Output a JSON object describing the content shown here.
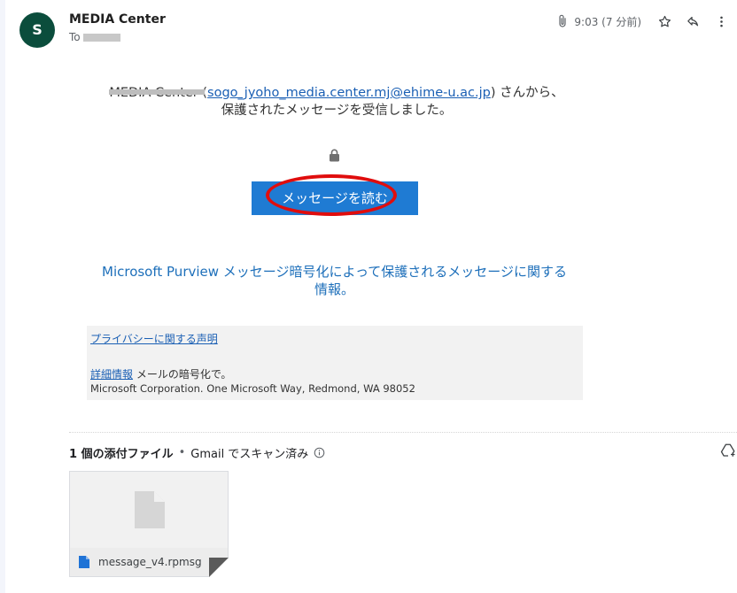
{
  "sender": {
    "initial": "S",
    "name": "MEDIA Center",
    "to_prefix": "To"
  },
  "header": {
    "time": "9:03 (7 分前)"
  },
  "body": {
    "sender_label": "MEDIA Center (",
    "sender_email": "sogo_jyoho_media.center.mj@ehime-u.ac.jp",
    "sender_suffix": ") さんから、",
    "line2": "保護されたメッセージを受信しました。",
    "read_button": "メッセージを読む",
    "purview_link": "Microsoft Purview メッセージ暗号化によって保護されるメッセージに関する情報。"
  },
  "footer": {
    "privacy_link": "プライバシーに関する声明",
    "details_link": "詳細情報",
    "details_text": " メールの暗号化で。",
    "ms_corp": "Microsoft Corporation. One Microsoft Way, Redmond, WA 98052"
  },
  "attachments": {
    "count_label": "1 個の添付ファイル",
    "separator": "•",
    "scan_label": "Gmail でスキャン済み",
    "items": [
      {
        "name": "message_v4.rpmsg"
      }
    ]
  },
  "colors": {
    "avatar": "#0b4d3c",
    "button": "#1f7bd3",
    "link": "#1a5fb4",
    "annotation": "#e00d0d"
  }
}
